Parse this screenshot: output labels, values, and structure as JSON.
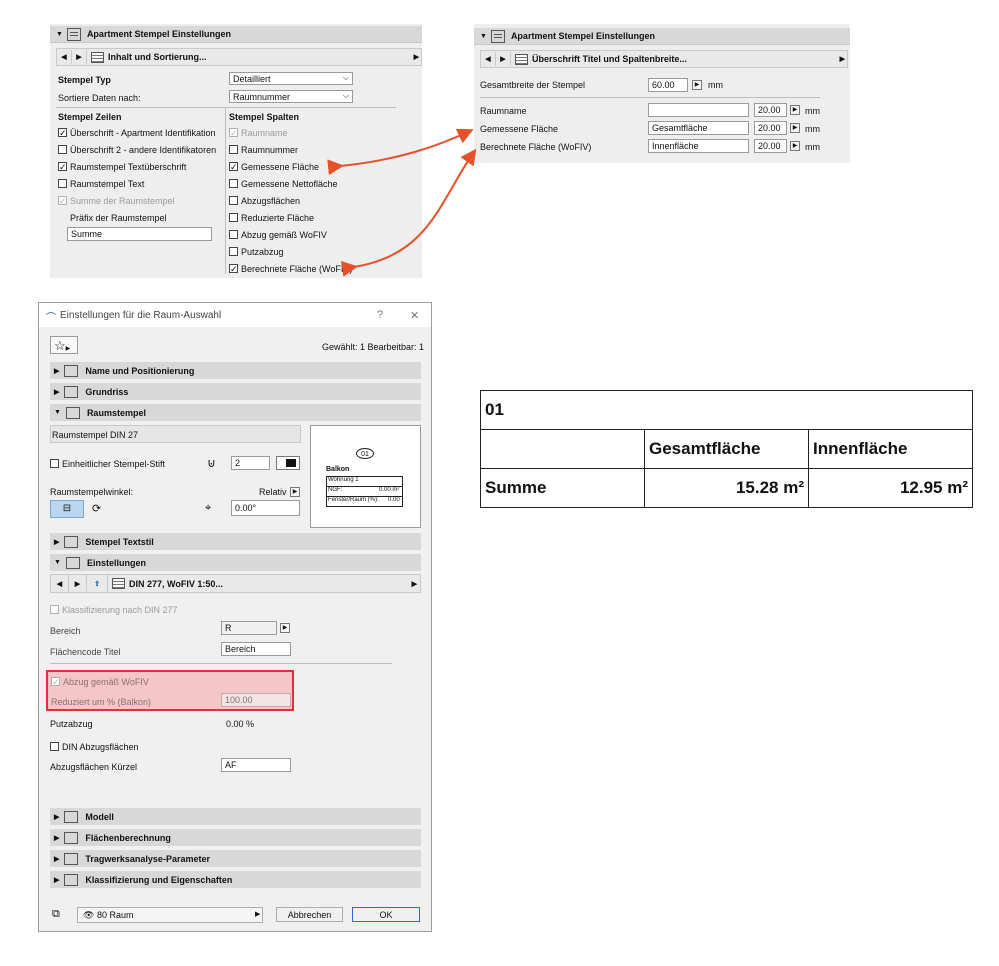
{
  "panel1": {
    "header": "Apartment Stempel Einstellungen",
    "nav_title": "Inhalt und Sortierung...",
    "stempel_typ_label": "Stempel Typ",
    "stempel_typ_value": "Detailliert",
    "sortiere_label": "Sortiere Daten nach:",
    "sortiere_value": "Raumnummer",
    "zeilen_header": "Stempel Zeilen",
    "spalten_header": "Stempel Spalten",
    "zeilen": [
      {
        "label": "Überschrift - Apartment Identifikation",
        "checked": true
      },
      {
        "label": "Überschrift 2 - andere Identifikatoren",
        "checked": false
      },
      {
        "label": "Raumstempel Textüberschrift",
        "checked": true
      },
      {
        "label": "Raumstempel Text",
        "checked": false
      },
      {
        "label": "Summe der Raumstempel",
        "checked": true,
        "disabled": true
      }
    ],
    "praefix_label": "Präfix der Raumstempel",
    "praefix_value": "Summe",
    "spalten": [
      {
        "label": "Raumname",
        "checked": true,
        "disabled": true
      },
      {
        "label": "Raumnummer",
        "checked": false
      },
      {
        "label": "Gemessene Fläche",
        "checked": true
      },
      {
        "label": "Gemessene Nettofläche",
        "checked": false
      },
      {
        "label": "Abzugsflächen",
        "checked": false
      },
      {
        "label": "Reduzierte Fläche",
        "checked": false
      },
      {
        "label": "Abzug gemäß WoFIV",
        "checked": false
      },
      {
        "label": "Putzabzug",
        "checked": false
      },
      {
        "label": "Berechnete Fläche (WoFIV)",
        "checked": true
      }
    ]
  },
  "panel2": {
    "header": "Apartment Stempel Einstellungen",
    "nav_title": "Überschrift Titel und Spaltenbreite...",
    "gesamtbreite_label": "Gesamtbreite der Stempel",
    "gesamtbreite_value": "60.00",
    "unit": "mm",
    "rows": [
      {
        "label": "Raumname",
        "value": "",
        "width": "20.00"
      },
      {
        "label": "Gemessene Fläche",
        "value": "Gesamtfläche",
        "width": "20.00"
      },
      {
        "label": "Berechnete Fläche (WoFIV)",
        "value": "Innenfläche",
        "width": "20.00"
      }
    ]
  },
  "dialog": {
    "title": "Einstellungen für die Raum-Auswahl",
    "help": "?",
    "close": "✕",
    "selection_info": "Gewählt: 1 Bearbeitbar: 1",
    "sections_top": [
      "Name und Positionierung",
      "Grundriss",
      "Raumstempel"
    ],
    "raumstempel_name": "Raumstempel DIN 27",
    "einheitlicher_label": "Einheitlicher Stempel-Stift",
    "pen_value": "2",
    "winkel_label": "Raumstempelwinkel:",
    "relativ_label": "Relativ",
    "angle_value": "0.00°",
    "preview": {
      "number": "01",
      "name": "Balkon",
      "line1": "Wohnung 1",
      "ngf_label": "NGF:",
      "ngf_value": "0.00 m²",
      "fenster_label": "Fenster/Raum (%):",
      "fenster_value": "0.00"
    },
    "textstil_section": "Stempel Textstil",
    "einstellungen_section": "Einstellungen",
    "nav_title": "DIN 277, WoFIV 1:50...",
    "klassifizierung_label": "Klassifizierung nach DIN 277",
    "bereich_label": "Bereich",
    "bereich_value": "R",
    "flaechencode_label": "Flächencode Titel",
    "flaechencode_value": "Bereich",
    "abzug_label": "Abzug gemäß WoFIV",
    "reduziert_label": "Reduziert um % (Balkon)",
    "reduziert_value": "100.00",
    "putzabzug_label": "Putzabzug",
    "putzabzug_value": "0.00 %",
    "din_abzug_label": "DIN Abzugsflächen",
    "abzug_kuerzel_label": "Abzugsflächen Kürzel",
    "abzug_kuerzel_value": "AF",
    "sections_bottom": [
      "Modell",
      "Flächenberechnung",
      "Tragwerksanalyse-Parameter",
      "Klassifizierung und Eigenschaften"
    ],
    "layer_value": "80 Raum",
    "cancel": "Abbrechen",
    "ok": "OK"
  },
  "stamp_table": {
    "number": "01",
    "col1": "Gesamtfläche",
    "col2": "Innenfläche",
    "row_label": "Summe",
    "val1": "15.28 m²",
    "val2": "12.95 m²"
  },
  "colors": {
    "panel_bg": "#eeeeee",
    "header_bg": "#d8d8d8",
    "arrow": "#e8502a",
    "highlight_border": "#e0303a",
    "highlight_fill": "#f4c6c6",
    "ok_border": "#2b6fd0"
  }
}
